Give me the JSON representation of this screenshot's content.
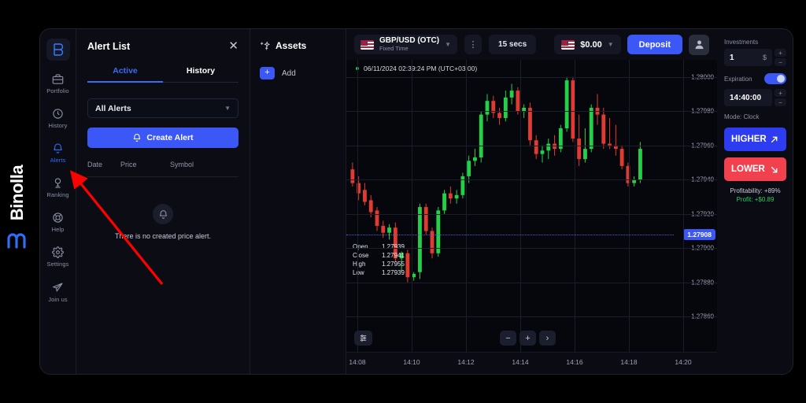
{
  "brand": {
    "name": "Binolla",
    "mark": "m"
  },
  "rail": {
    "logo": "B",
    "items": [
      {
        "label": "Portfolio",
        "icon": "briefcase-icon"
      },
      {
        "label": "History",
        "icon": "clock-icon"
      },
      {
        "label": "Alerts",
        "icon": "bell-icon"
      },
      {
        "label": "Ranking",
        "icon": "trophy-icon"
      },
      {
        "label": "Help",
        "icon": "lifebuoy-icon"
      },
      {
        "label": "Settings",
        "icon": "gear-icon"
      },
      {
        "label": "Join us",
        "icon": "telegram-icon"
      }
    ],
    "active": "Alerts"
  },
  "alert_panel": {
    "title": "Alert List",
    "close": "✕",
    "tabs": [
      {
        "label": "Active",
        "active": true
      },
      {
        "label": "History",
        "active": false
      }
    ],
    "filter_value": "All Alerts",
    "create_button": "Create Alert",
    "columns": [
      "Date",
      "Price",
      "Symbol"
    ],
    "empty_text": "There is no created price alert."
  },
  "assets_panel": {
    "title": "Assets",
    "add_label": "Add",
    "add_symbol": "+"
  },
  "chart_header": {
    "symbol": "GBP/USD (OTC)",
    "symbol_sub": "Fixed Time",
    "menu_icon": "⋮",
    "timeframe": "15 secs",
    "balance": "$0.00",
    "deposit": "Deposit"
  },
  "chart_data": {
    "type": "candlestick",
    "title": "GBP/USD (OTC)",
    "timestamp": "06/11/2024 02:39:24 PM  (UTC+03:00)",
    "ylabel": "",
    "xlabel": "",
    "ylim": [
      1.2785,
      1.2801
    ],
    "price_ticks": [
      "1.28000",
      "1.27980",
      "1.27960",
      "1.27940",
      "1.27920",
      "1.27900",
      "1.27880",
      "1.27860"
    ],
    "time_ticks": [
      "14:08",
      "14:10",
      "14:12",
      "14:14",
      "14:16",
      "14:18",
      "14:20"
    ],
    "current_price": "1.27908",
    "ohlc": {
      "open_label": "Open",
      "open": "1.27939",
      "close_label": "Close",
      "close": "1.27941",
      "high_label": "High",
      "high": "1.27955",
      "low_label": "Low",
      "low": "1.27939"
    },
    "colors": {
      "up": "#24d04a",
      "down": "#e03b33",
      "grid": "#1a1d2a",
      "background": "#06070c",
      "current": "#3b57f6"
    },
    "candles": [
      {
        "o": 1.27946,
        "h": 1.2795,
        "l": 1.27936,
        "c": 1.27938
      },
      {
        "o": 1.27938,
        "h": 1.27942,
        "l": 1.27928,
        "c": 1.27932
      },
      {
        "o": 1.27934,
        "h": 1.27938,
        "l": 1.27925,
        "c": 1.27927
      },
      {
        "o": 1.27928,
        "h": 1.27931,
        "l": 1.27918,
        "c": 1.27921
      },
      {
        "o": 1.27922,
        "h": 1.27924,
        "l": 1.2791,
        "c": 1.27913
      },
      {
        "o": 1.27913,
        "h": 1.27916,
        "l": 1.27906,
        "c": 1.27909
      },
      {
        "o": 1.27909,
        "h": 1.27914,
        "l": 1.27905,
        "c": 1.27912
      },
      {
        "o": 1.27912,
        "h": 1.27915,
        "l": 1.27892,
        "c": 1.27894
      },
      {
        "o": 1.27894,
        "h": 1.27898,
        "l": 1.27886,
        "c": 1.27897
      },
      {
        "o": 1.27897,
        "h": 1.27899,
        "l": 1.2788,
        "c": 1.27883
      },
      {
        "o": 1.27883,
        "h": 1.27886,
        "l": 1.27881,
        "c": 1.27885
      },
      {
        "o": 1.27886,
        "h": 1.27926,
        "l": 1.27882,
        "c": 1.27924
      },
      {
        "o": 1.27924,
        "h": 1.27926,
        "l": 1.27908,
        "c": 1.2791
      },
      {
        "o": 1.2791,
        "h": 1.27912,
        "l": 1.27894,
        "c": 1.27897
      },
      {
        "o": 1.27897,
        "h": 1.27924,
        "l": 1.27895,
        "c": 1.27922
      },
      {
        "o": 1.27922,
        "h": 1.27934,
        "l": 1.2792,
        "c": 1.27932
      },
      {
        "o": 1.27932,
        "h": 1.27936,
        "l": 1.27926,
        "c": 1.27929
      },
      {
        "o": 1.27929,
        "h": 1.27934,
        "l": 1.27926,
        "c": 1.27931
      },
      {
        "o": 1.27931,
        "h": 1.27944,
        "l": 1.27929,
        "c": 1.27942
      },
      {
        "o": 1.27942,
        "h": 1.27954,
        "l": 1.27938,
        "c": 1.27951
      },
      {
        "o": 1.27951,
        "h": 1.27958,
        "l": 1.27948,
        "c": 1.27953
      },
      {
        "o": 1.27953,
        "h": 1.2798,
        "l": 1.2795,
        "c": 1.27978
      },
      {
        "o": 1.27978,
        "h": 1.2799,
        "l": 1.27974,
        "c": 1.27986
      },
      {
        "o": 1.27986,
        "h": 1.27989,
        "l": 1.27976,
        "c": 1.27979
      },
      {
        "o": 1.27979,
        "h": 1.27982,
        "l": 1.27972,
        "c": 1.27976
      },
      {
        "o": 1.27976,
        "h": 1.27992,
        "l": 1.27974,
        "c": 1.27988
      },
      {
        "o": 1.27988,
        "h": 1.27996,
        "l": 1.27984,
        "c": 1.27992
      },
      {
        "o": 1.27992,
        "h": 1.27994,
        "l": 1.27978,
        "c": 1.2798
      },
      {
        "o": 1.2798,
        "h": 1.27984,
        "l": 1.27976,
        "c": 1.27982
      },
      {
        "o": 1.27982,
        "h": 1.27985,
        "l": 1.2796,
        "c": 1.27963
      },
      {
        "o": 1.27963,
        "h": 1.27966,
        "l": 1.27952,
        "c": 1.27955
      },
      {
        "o": 1.27955,
        "h": 1.2796,
        "l": 1.2795,
        "c": 1.27957
      },
      {
        "o": 1.27957,
        "h": 1.27964,
        "l": 1.27952,
        "c": 1.27961
      },
      {
        "o": 1.27961,
        "h": 1.27966,
        "l": 1.27954,
        "c": 1.27958
      },
      {
        "o": 1.27958,
        "h": 1.27972,
        "l": 1.27956,
        "c": 1.2797
      },
      {
        "o": 1.2797,
        "h": 1.28,
        "l": 1.27968,
        "c": 1.27998
      },
      {
        "o": 1.27998,
        "h": 1.28,
        "l": 1.27962,
        "c": 1.27964
      },
      {
        "o": 1.27964,
        "h": 1.27978,
        "l": 1.27948,
        "c": 1.27952
      },
      {
        "o": 1.27952,
        "h": 1.2797,
        "l": 1.2795,
        "c": 1.27958
      },
      {
        "o": 1.27958,
        "h": 1.27984,
        "l": 1.27956,
        "c": 1.27982
      },
      {
        "o": 1.27982,
        "h": 1.2799,
        "l": 1.27972,
        "c": 1.27978
      },
      {
        "o": 1.27978,
        "h": 1.27982,
        "l": 1.27958,
        "c": 1.27961
      },
      {
        "o": 1.27961,
        "h": 1.27976,
        "l": 1.27958,
        "c": 1.2796
      },
      {
        "o": 1.2796,
        "h": 1.27972,
        "l": 1.27954,
        "c": 1.27958
      },
      {
        "o": 1.27958,
        "h": 1.2796,
        "l": 1.27946,
        "c": 1.27948
      },
      {
        "o": 1.27948,
        "h": 1.2795,
        "l": 1.27936,
        "c": 1.27938
      },
      {
        "o": 1.27938,
        "h": 1.27942,
        "l": 1.27936,
        "c": 1.2794
      },
      {
        "o": 1.2794,
        "h": 1.27962,
        "l": 1.27938,
        "c": 1.27958
      }
    ]
  },
  "chart_controls": {
    "settings_icon": "sliders-icon",
    "zoom_out": "−",
    "zoom_in": "+",
    "forward": "›"
  },
  "trade_panel": {
    "investments_label": "Investments",
    "investment_value": "1",
    "currency": "$",
    "expiration_label": "Expiration",
    "expiration_value": "14:40:00",
    "mode": "Mode: Clock",
    "higher": "HIGHER",
    "lower": "LOWER",
    "profitability": "Profitability: +89%",
    "profit": "Profit: +$0.89",
    "step_up": "+",
    "step_down": "−"
  },
  "annotation": {
    "color": "#ff0000",
    "points": "from (205,360) to (90,218)"
  }
}
